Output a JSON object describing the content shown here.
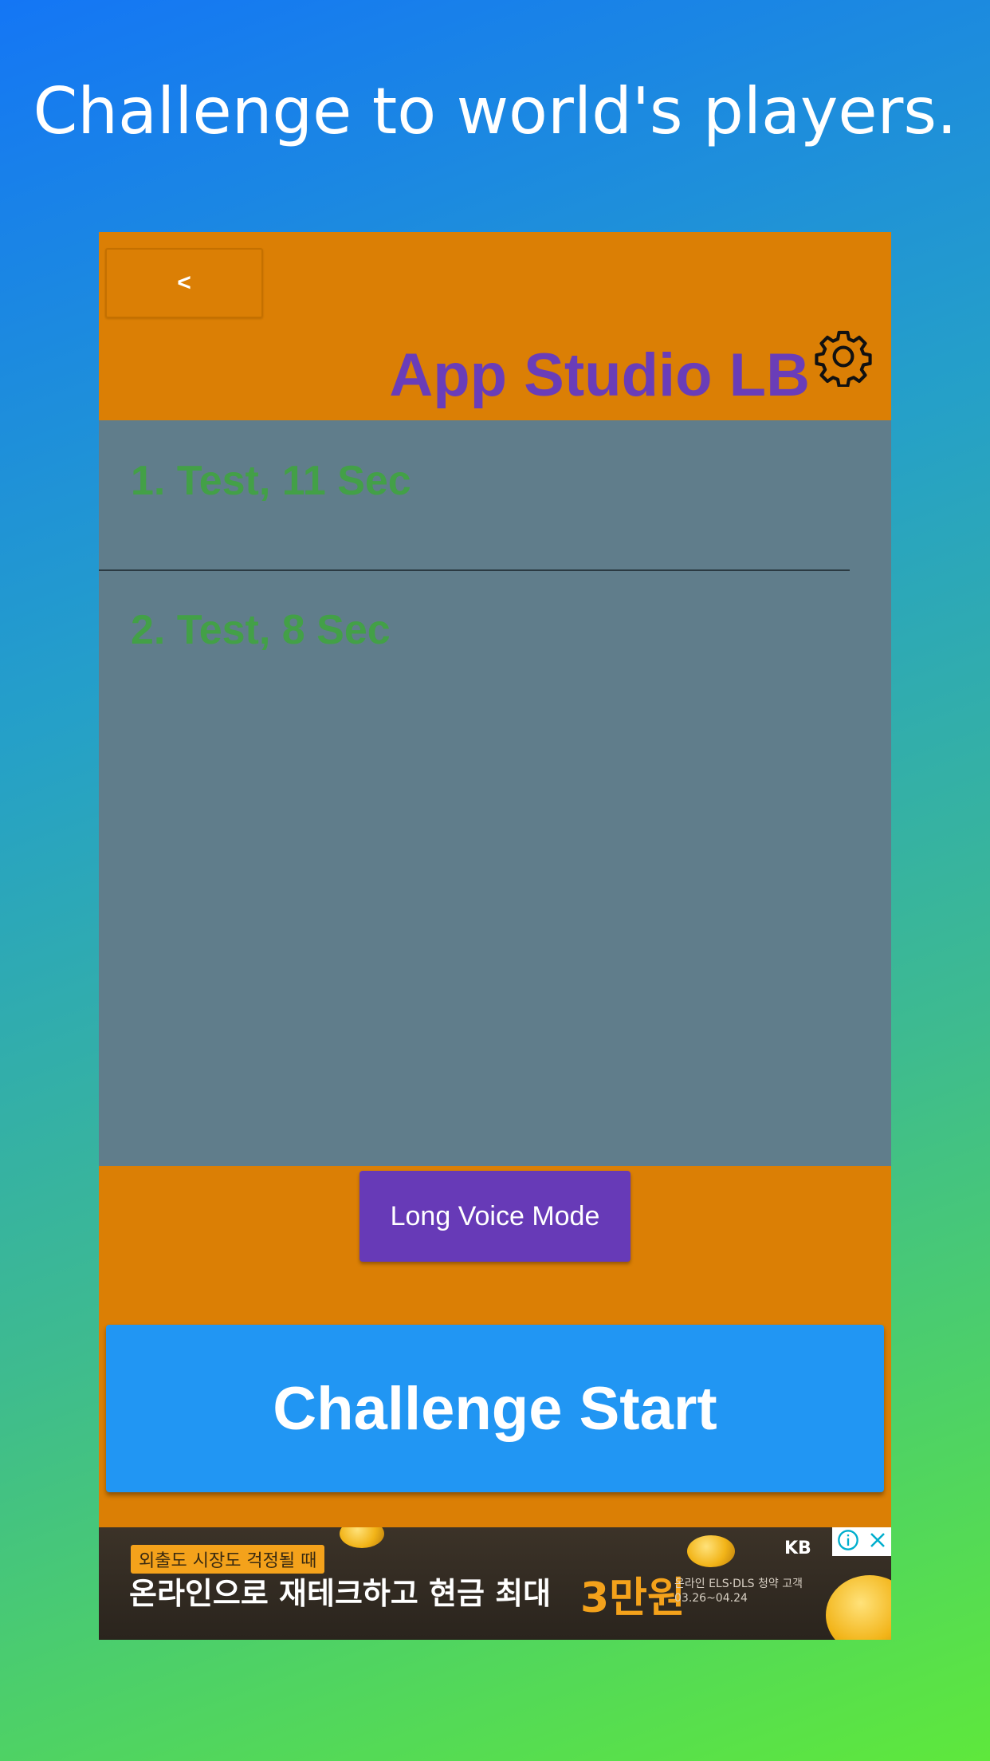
{
  "headline": "Challenge to world's players.",
  "header": {
    "back_label": "<",
    "title": "App Studio LB",
    "settings_icon": "gear-icon"
  },
  "leaderboard": {
    "items": [
      {
        "label": "1. Test, 11 Sec"
      },
      {
        "label": "2. Test, 8 Sec"
      }
    ]
  },
  "buttons": {
    "voice_mode_label": "Long Voice Mode",
    "challenge_start_label": "Challenge Start"
  },
  "ad": {
    "tag": "외출도 시장도 걱정될 때",
    "main_text": "온라인으로 재테크하고 현금 최대",
    "accent_text": "3만원",
    "side_text_1": "온라인 ELS·DLS 청약 고객",
    "side_text_2": "03.26~04.24",
    "logo_text": "KB",
    "info_icon": "info-icon",
    "close_icon": "close-icon"
  },
  "colors": {
    "panel": "#db7f05",
    "list_bg": "#607d8b",
    "title": "#6a3db8",
    "list_text": "#43a047",
    "voice_button": "#673ab7",
    "start_button": "#2196f3"
  }
}
